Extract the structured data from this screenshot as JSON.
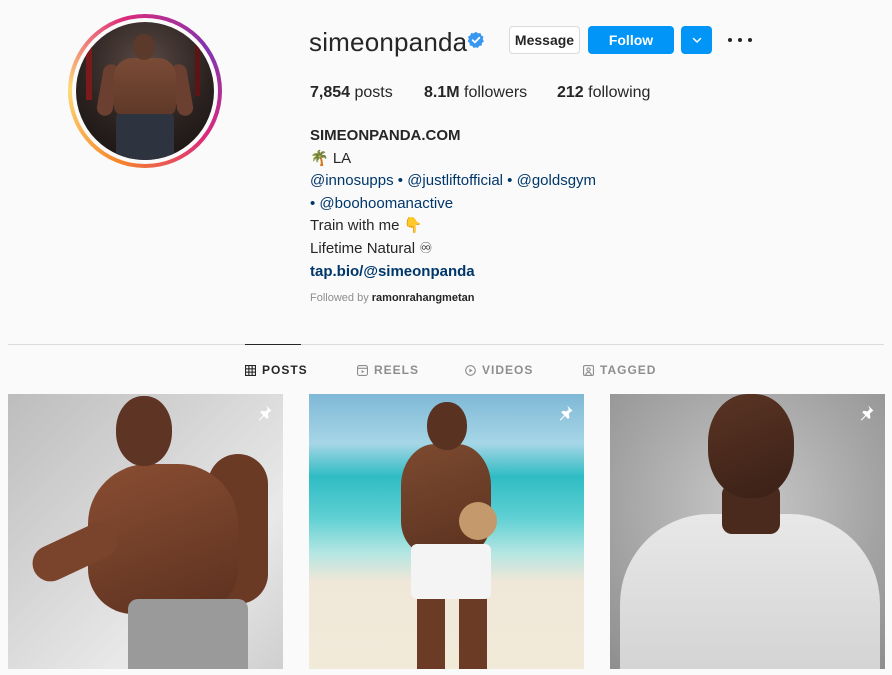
{
  "profile": {
    "username": "simeonpanda",
    "message_label": "Message",
    "follow_label": "Follow",
    "dropdown_icon": "chevron-down-icon",
    "more_icon": "more-options-icon",
    "accent_color": "#0095f6"
  },
  "stats": {
    "posts_count": "7,854",
    "posts_label": "posts",
    "followers_count": "8.1M",
    "followers_label": "followers",
    "following_count": "212",
    "following_label": "following"
  },
  "bio": {
    "name": "SIMEONPANDA.COM",
    "location": "🌴 LA",
    "mentions_line1": "@innosupps • @justliftofficial • @goldsgym",
    "mentions_line2": "• @boohoomanactive",
    "train_line": "Train with me 👇",
    "natural_line": "Lifetime Natural ♾",
    "link": "tap.bio/@simeonpanda"
  },
  "followed_by": {
    "prefix": "Followed by",
    "user": "ramonrahangmetan"
  },
  "tabs": [
    {
      "label": "POSTS",
      "icon": "grid-icon",
      "active": true
    },
    {
      "label": "REELS",
      "icon": "reels-icon",
      "active": false
    },
    {
      "label": "VIDEOS",
      "icon": "video-play-icon",
      "active": false
    },
    {
      "label": "TAGGED",
      "icon": "tagged-icon",
      "active": false
    }
  ],
  "posts": [
    {
      "pinned": true
    },
    {
      "pinned": true
    },
    {
      "pinned": true
    }
  ]
}
